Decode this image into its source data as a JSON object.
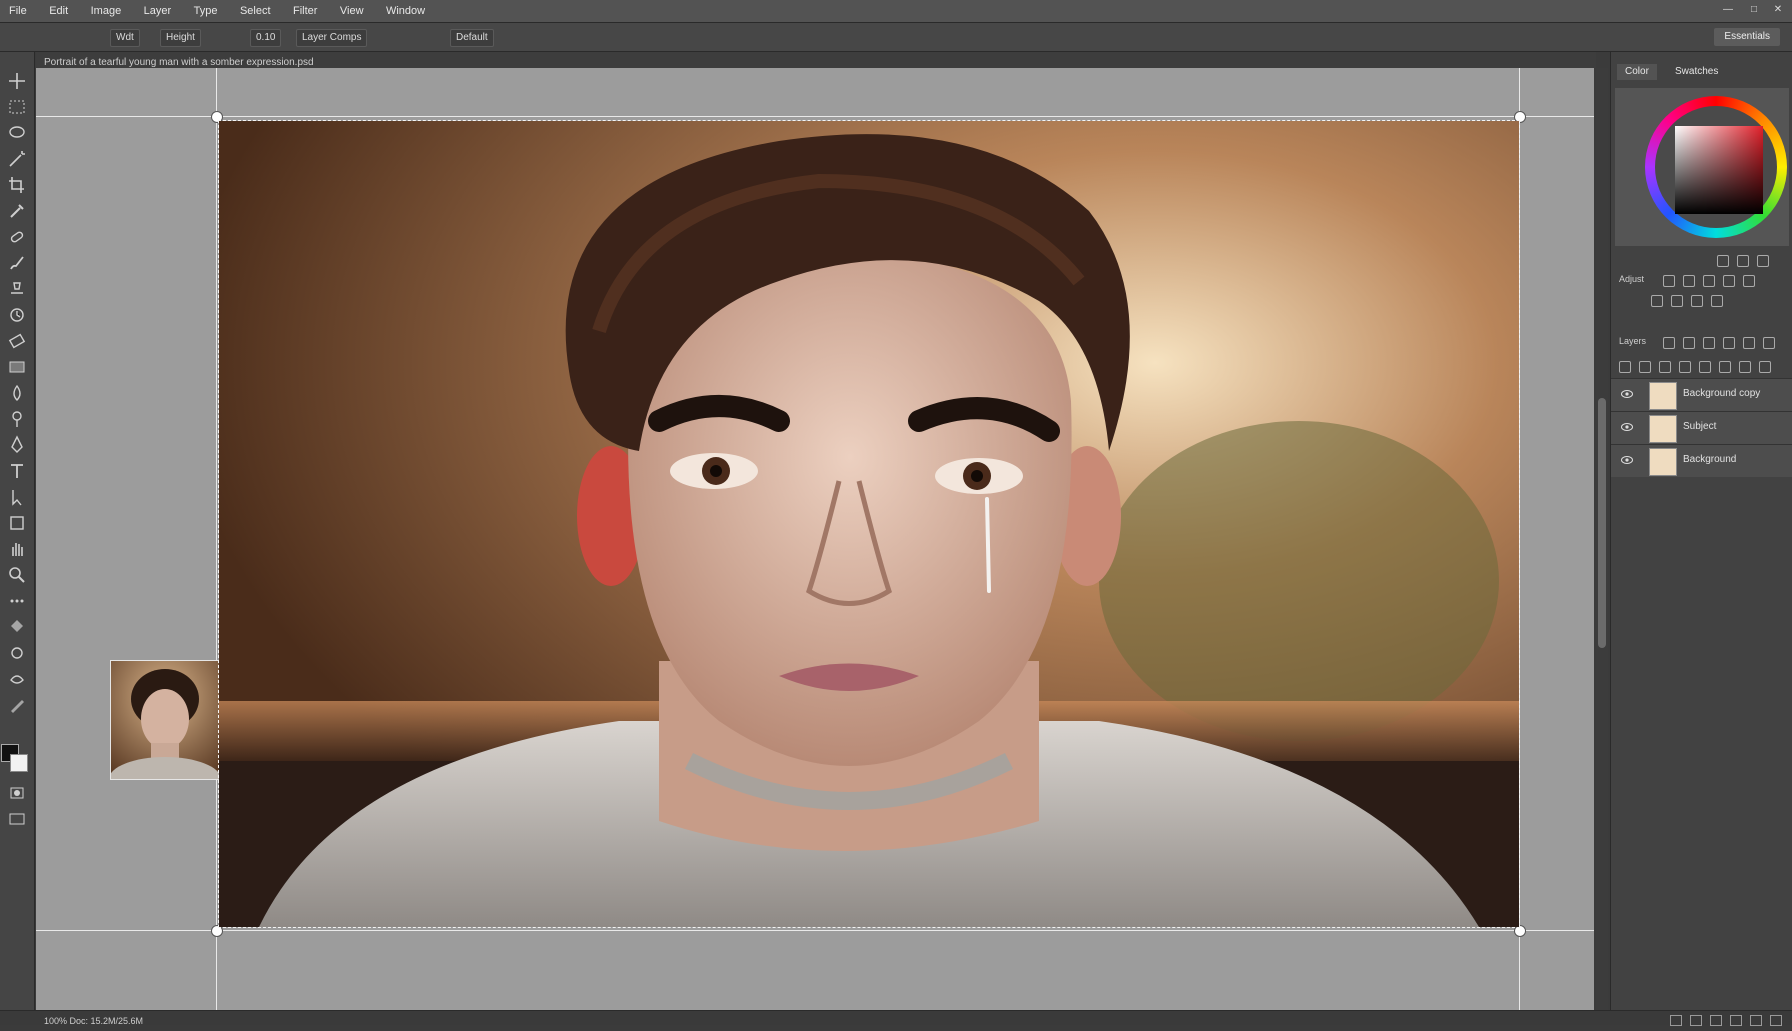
{
  "menubar": {
    "items": [
      "File",
      "Edit",
      "Image",
      "Layer",
      "Type",
      "Select",
      "Filter",
      "View",
      "Window"
    ]
  },
  "options_bar": {
    "items": [
      "Wdt",
      "Height",
      "0.10",
      "Layer Comps",
      "Default"
    ],
    "workspace": "Essentials"
  },
  "document": {
    "tab_title": "Portrait of a tearful young man with a somber expression.psd"
  },
  "right_panel": {
    "tabs": [
      "Color",
      "Swatches"
    ],
    "adjustments_label": "Adjust",
    "layers_label": "Layers",
    "layers": [
      {
        "name": "Background copy",
        "visible": true
      },
      {
        "name": "Subject",
        "visible": true
      },
      {
        "name": "Background",
        "visible": true
      }
    ]
  },
  "status": {
    "text": "100%   Doc: 15.2M/25.6M"
  },
  "colors": {
    "accent": "#e1202a",
    "panel": "#424242",
    "canvas": "#9c9c9c"
  }
}
